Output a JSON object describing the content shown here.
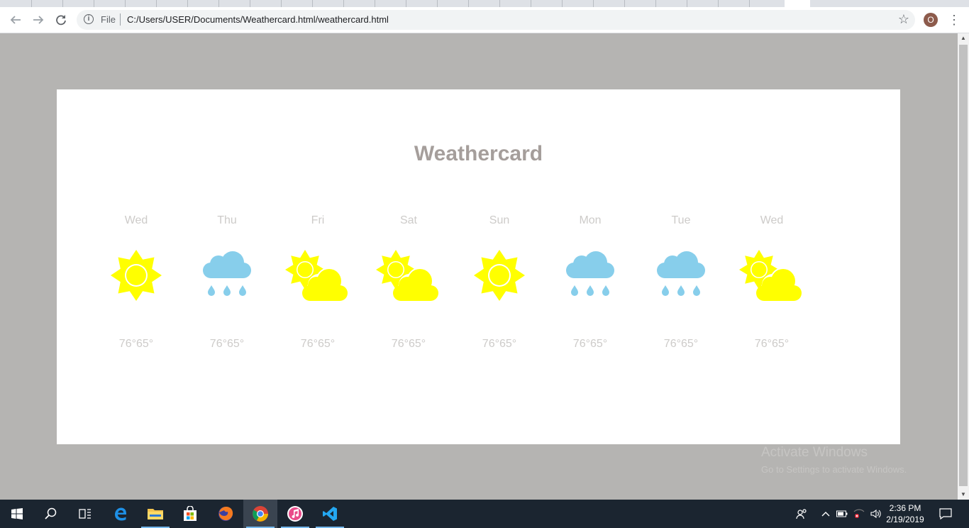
{
  "browser": {
    "scheme_label": "File",
    "url": "C:/Users/USER/Documents/Weathercard.html/weathercard.html",
    "profile_initial": "O",
    "menu_glyph": "⋮",
    "bookmark_glyph": "☆",
    "info_glyph": "i"
  },
  "card": {
    "title": "Weathercard",
    "days": [
      {
        "name": "Wed",
        "icon": "sun-icon",
        "temp": "76°65°"
      },
      {
        "name": "Thu",
        "icon": "rain-icon",
        "temp": "76°65°"
      },
      {
        "name": "Fri",
        "icon": "partly-cloudy-icon",
        "temp": "76°65°"
      },
      {
        "name": "Sat",
        "icon": "partly-cloudy-icon",
        "temp": "76°65°"
      },
      {
        "name": "Sun",
        "icon": "sun-icon",
        "temp": "76°65°"
      },
      {
        "name": "Mon",
        "icon": "rain-icon",
        "temp": "76°65°"
      },
      {
        "name": "Tue",
        "icon": "rain-icon",
        "temp": "76°65°"
      },
      {
        "name": "Wed",
        "icon": "partly-cloudy-icon",
        "temp": "76°65°"
      }
    ]
  },
  "watermark": {
    "line1": "Activate Windows",
    "line2": "Go to Settings to activate Windows."
  },
  "taskbar": {
    "time": "2:36 PM",
    "date": "2/19/2019"
  },
  "colors": {
    "sun": "#ffff00",
    "rain_cloud": "#87ceeb",
    "title": "#a59e9b",
    "muted_text": "#cdcbc9",
    "page_background": "#b5b4b2"
  }
}
